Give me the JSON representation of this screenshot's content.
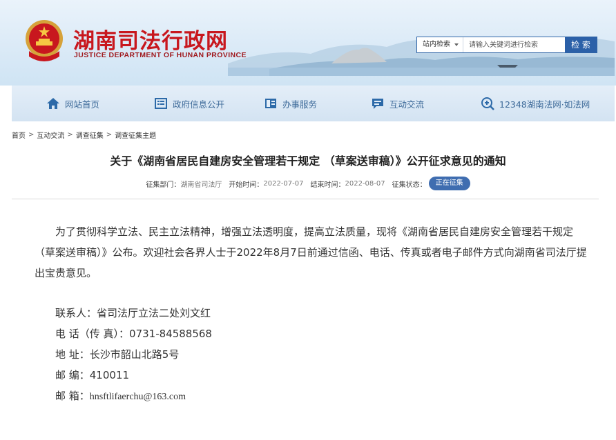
{
  "header": {
    "site_title": "湖南司法行政网",
    "site_subtitle": "JUSTICE DEPARTMENT OF HUNAN PROVINCE",
    "search": {
      "scope": "站内检索",
      "placeholder": "请输入关键词进行检索",
      "button": "检 索"
    }
  },
  "nav": {
    "items": [
      {
        "label": "网站首页",
        "icon": "home-icon"
      },
      {
        "label": "政府信息公开",
        "icon": "list-icon"
      },
      {
        "label": "办事服务",
        "icon": "book-icon"
      },
      {
        "label": "互动交流",
        "icon": "chat-icon"
      },
      {
        "label": "12348湖南法网·如法网",
        "icon": "search-plus-icon"
      }
    ]
  },
  "breadcrumb": [
    "首页",
    "互动交流",
    "调查征集",
    "调查征集主题"
  ],
  "article": {
    "title": "关于《湖南省居民自建房安全管理若干规定 （草案送审稿）》公开征求意见的通知",
    "meta": {
      "dept_label": "征集部门：",
      "dept": "湖南省司法厅",
      "start_label": "开始时间：",
      "start": "2022-07-07",
      "end_label": "结束时间：",
      "end": "2022-08-07",
      "status_label": "征集状态：",
      "status": "正在征集"
    },
    "body": "为了贯彻科学立法、民主立法精神，增强立法透明度，提高立法质量，现将《湖南省居民自建房安全管理若干规定（草案送审稿）》公布。欢迎社会各界人士于2022年8月7日前通过信函、电话、传真或者电子邮件方式向湖南省司法厅提出宝贵意见。",
    "contacts": {
      "person": "联系人：省司法厅立法二处刘文红",
      "phone": "电 话（传 真）：0731-84588568",
      "address": "地 址：长沙市韶山北路5号",
      "postcode": "邮 编：410011",
      "email_label": "邮 箱：",
      "email": "hnsftlifaerchu@163.com"
    }
  },
  "colors": {
    "title_red": "#c8171e",
    "nav_text": "#3d6a99",
    "accent_blue": "#2b60a8",
    "badge_blue": "#3f6db0"
  }
}
